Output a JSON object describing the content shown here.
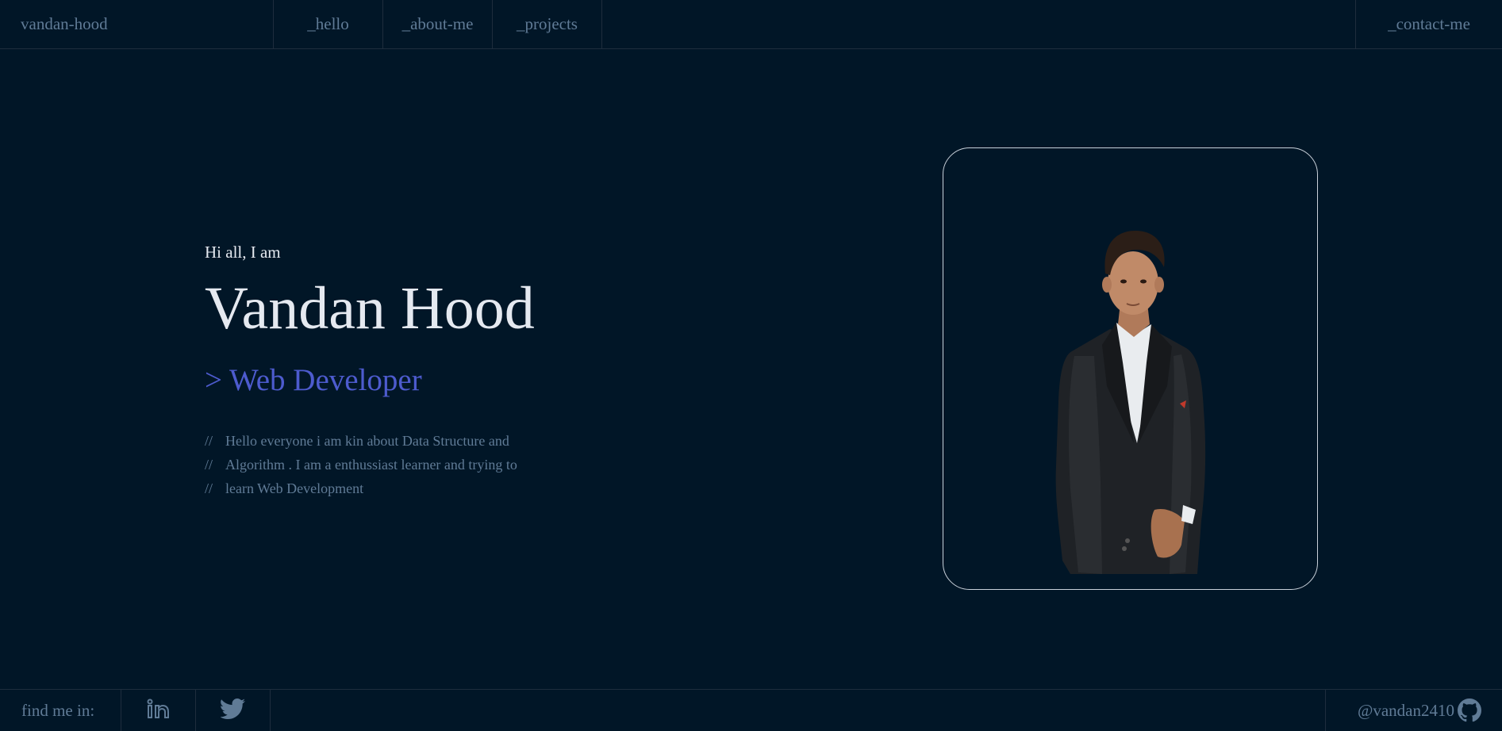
{
  "header": {
    "brand": "vandan-hood",
    "nav": {
      "hello": "_hello",
      "about": "_about-me",
      "projects": "_projects",
      "contact": "_contact-me"
    }
  },
  "hero": {
    "greeting": "Hi all, I am",
    "name": "Vandan Hood",
    "role": "> Web Developer",
    "bio": {
      "prefix": "//",
      "lines": [
        "Hello everyone i am kin about Data Structure and",
        "Algorithm . I am a enthussiast learner and trying to",
        "learn Web Development"
      ]
    }
  },
  "profile": {
    "photo_icon": "person-photo"
  },
  "footer": {
    "find_label": "find me in:",
    "social": {
      "linkedin_icon": "linkedin-icon",
      "twitter_icon": "twitter-icon"
    },
    "github_handle": "@vandan2410",
    "github_icon": "github-icon"
  },
  "colors": {
    "background": "#011627",
    "border": "#1e2d3d",
    "text_muted": "#607b96",
    "text_light": "#e5e9f0",
    "accent": "#4d5bce"
  }
}
